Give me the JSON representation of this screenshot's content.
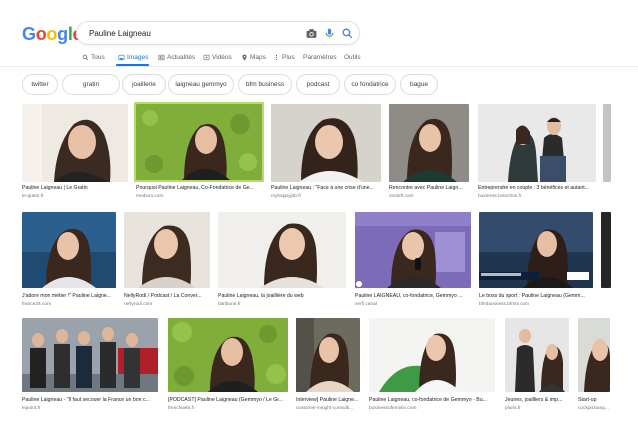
{
  "logo": {
    "letters": [
      "G",
      "o",
      "o",
      "g",
      "l",
      "e"
    ],
    "colors": [
      "#4285f4",
      "#ea4335",
      "#fbbc05",
      "#4285f4",
      "#34a853",
      "#ea4335"
    ]
  },
  "search": {
    "value": "Pauline Laigneau"
  },
  "tabs": [
    {
      "label": "Tous",
      "icon": "search-icon"
    },
    {
      "label": "Images",
      "icon": "image-icon",
      "active": true
    },
    {
      "label": "Actualités",
      "icon": "news-icon"
    },
    {
      "label": "Vidéos",
      "icon": "video-icon"
    },
    {
      "label": "Maps",
      "icon": "map-pin-icon"
    },
    {
      "label": "Plus",
      "icon": "more-dots-icon"
    },
    {
      "label": "Paramètres"
    },
    {
      "label": "Outils"
    }
  ],
  "chips": [
    "twitter",
    "gratin",
    "joaillerie",
    "laigneau gemmyo",
    "bfm business",
    "podcast",
    "co fondatrice",
    "bague"
  ],
  "results": [
    {
      "caption": "Pauline Laigneau | Le Gratin",
      "source": "le-gratin.fr"
    },
    {
      "caption": "Pourquoi Pauline Laigneau, Co-Fondatrice de Ge...",
      "source": "medium.com"
    },
    {
      "caption": "Pauline Laigneau : \"Face à une crise d'une...",
      "source": "myhappyjob.fr"
    },
    {
      "caption": "Rencontre avec Pauline Laign...",
      "source": "zeeloft.com"
    },
    {
      "caption": "Entreprendre en couple : 3 bénéfices et autant...",
      "source": "business.lesechos.fr"
    },
    {
      "caption": "J'adore mon métier !\" Pauline Laigne...",
      "source": "france24.com"
    },
    {
      "caption": "NellyRodi / Podcast / La Conver...",
      "source": "nellyrodi.com"
    },
    {
      "caption": "Pauline Laigneau, la joaillière du web",
      "source": "latribune.fr"
    },
    {
      "caption": "Pauline LAIGNEAU, co-fondatrice, Gemmyo ...",
      "source": "xerfi canal"
    },
    {
      "caption": "Le boss du sport : Pauline Laigneau (Gemm...",
      "source": "bfmbusiness.bfmtv.com"
    },
    {
      "caption": "Pauline Laigneau - \"Il faut secouer la France un bon c...",
      "source": "lepoint.fr"
    },
    {
      "caption": "[PODCAST] Pauline Laigneau (Gemmyo / Le Gr...",
      "source": "frenchweb.fr"
    },
    {
      "caption": "Interview] Pauline Laigne...",
      "source": "customer-insight-consulti..."
    },
    {
      "caption": "Pauline Laigneau, co-fondatrice de Gemmyo - Bu...",
      "source": "businessofeminin.com"
    },
    {
      "caption": "Jeunes, joailliers & imp...",
      "source": "pluris.fr"
    },
    {
      "caption": "Start-up",
      "source": "cockpit.bang..."
    }
  ]
}
